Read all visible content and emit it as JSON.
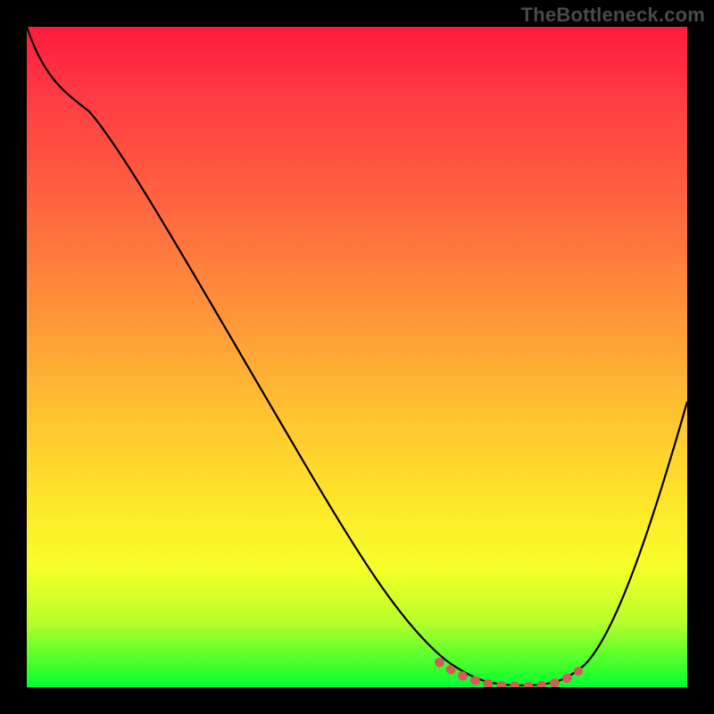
{
  "watermark": "TheBottleneck.com",
  "chart_data": {
    "type": "line",
    "title": "",
    "xlabel": "",
    "ylabel": "",
    "xlim": [
      0,
      100
    ],
    "ylim": [
      0,
      100
    ],
    "grid": false,
    "legend": false,
    "series": [
      {
        "name": "curve",
        "x": [
          0,
          5,
          10,
          20,
          30,
          40,
          50,
          60,
          65,
          70,
          75,
          80,
          85,
          90,
          95,
          100
        ],
        "y": [
          100,
          95,
          88,
          75,
          60,
          46,
          32,
          15,
          5,
          1,
          0,
          0,
          2,
          10,
          25,
          45
        ]
      }
    ],
    "highlight_range_x": [
      62,
      82
    ],
    "background_gradient": {
      "top": "#ff1a3e",
      "mid": "#ffe12a",
      "bottom": "#00ff33"
    }
  }
}
